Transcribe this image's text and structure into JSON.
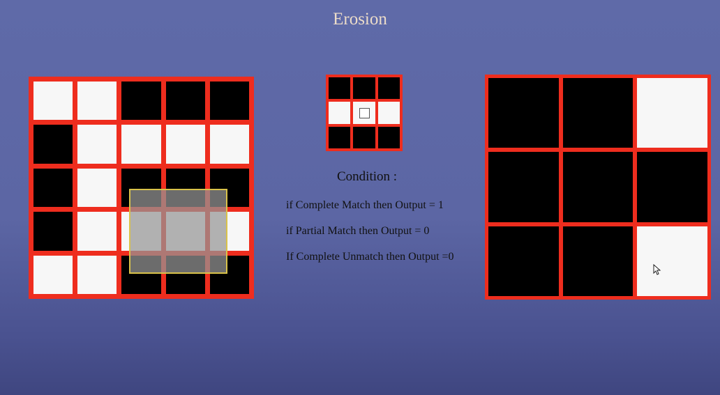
{
  "title": "Erosion",
  "input_grid": [
    [
      1,
      1,
      0,
      0,
      0
    ],
    [
      0,
      1,
      1,
      1,
      1
    ],
    [
      0,
      1,
      0,
      0,
      0
    ],
    [
      0,
      1,
      1,
      1,
      1
    ],
    [
      1,
      1,
      0,
      0,
      0
    ]
  ],
  "kernel_grid": [
    [
      0,
      0,
      0
    ],
    [
      1,
      1,
      1
    ],
    [
      0,
      0,
      0
    ]
  ],
  "output_grid": [
    [
      0,
      0,
      1
    ],
    [
      0,
      0,
      0
    ],
    [
      0,
      0,
      1
    ]
  ],
  "condition": {
    "title": "Condition :",
    "rules": [
      "if Complete Match then Output = 1",
      "if Partial Match then Output = 0",
      "If Complete Unmatch then Output =0"
    ]
  },
  "colors": {
    "grid_border": "#ee2d1e",
    "highlight_window": "#d9c24a"
  }
}
